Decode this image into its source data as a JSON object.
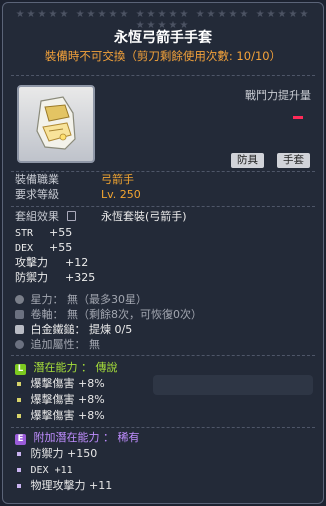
{
  "item": {
    "stars": "★★★★★ ★★★★★ ★★★★★ ★★★★★ ★★★★★ ★★★★★",
    "name": "永恆弓箭手手套",
    "trade_notice": "裝備時不可交換（剪刀剩餘使用次數: 10/10）",
    "combat_power_label": "戰鬥力提升量",
    "tags": [
      "防具",
      "手套"
    ],
    "job_label": "裝備職業",
    "job_value": "弓箭手",
    "level_label": "要求等級",
    "level_value": "Lv. 250",
    "set_label": "套組效果",
    "set_value": "永恆套裝(弓箭手)",
    "stats": [
      {
        "name": "STR",
        "value": "+55"
      },
      {
        "name": "DEX",
        "value": "+55"
      },
      {
        "name": "攻擊力",
        "value": "+12"
      },
      {
        "name": "防禦力",
        "value": "+325"
      }
    ],
    "star_force": {
      "label": "星力：",
      "value": "無（最多30星）"
    },
    "scroll": {
      "label": "卷軸：",
      "value": "無（剩餘8次，可恢復0次）"
    },
    "hammer": {
      "label": "白金鐵鎚：",
      "value": "提煉 0/5"
    },
    "extra_option": {
      "label": "追加屬性：",
      "value": "無"
    }
  },
  "potential": {
    "badge": "L",
    "title": "潛在能力 ： 傳說",
    "lines": [
      "爆擊傷害 +8%",
      "爆擊傷害 +8%",
      "爆擊傷害 +8%"
    ]
  },
  "bonus_potential": {
    "badge": "E",
    "title": "附加潛在能力 ： 稀有",
    "lines": [
      "防禦力 +150",
      "DEX +11",
      "物理攻擊力 +11"
    ]
  },
  "colors": {
    "name": "#ffffff",
    "notice": "#f5a33a",
    "job": "#f2a531",
    "potential_badge": "#7cc91f",
    "bonus_badge": "#9a5cd9",
    "cp_indicator": "#ff2a58"
  }
}
